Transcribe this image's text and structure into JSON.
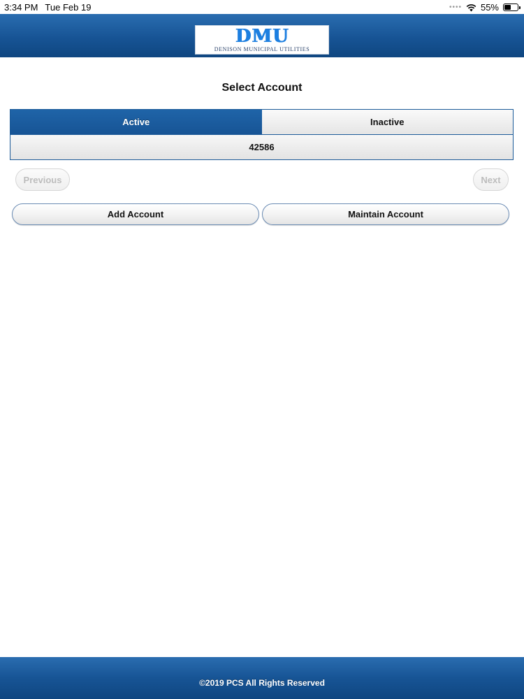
{
  "status_bar": {
    "time": "3:34 PM",
    "date": "Tue Feb 19",
    "battery_percent": "55%",
    "battery_level": 0.55,
    "wifi_icon": "wifi-icon",
    "battery_icon": "battery-icon"
  },
  "header": {
    "logo_mark": "DMU",
    "logo_subtitle": "DENISON MUNICIPAL UTILITIES",
    "background_color": "#175495"
  },
  "page": {
    "title": "Select Account"
  },
  "tabs": [
    {
      "label": "Active",
      "selected": true
    },
    {
      "label": "Inactive",
      "selected": false
    }
  ],
  "accounts": [
    {
      "number": "42586"
    }
  ],
  "pager": {
    "previous_label": "Previous",
    "next_label": "Next",
    "previous_enabled": false,
    "next_enabled": false
  },
  "actions": {
    "add_label": "Add Account",
    "maintain_label": "Maintain Account"
  },
  "footer": {
    "copyright": "©2019 PCS All Rights Reserved"
  }
}
